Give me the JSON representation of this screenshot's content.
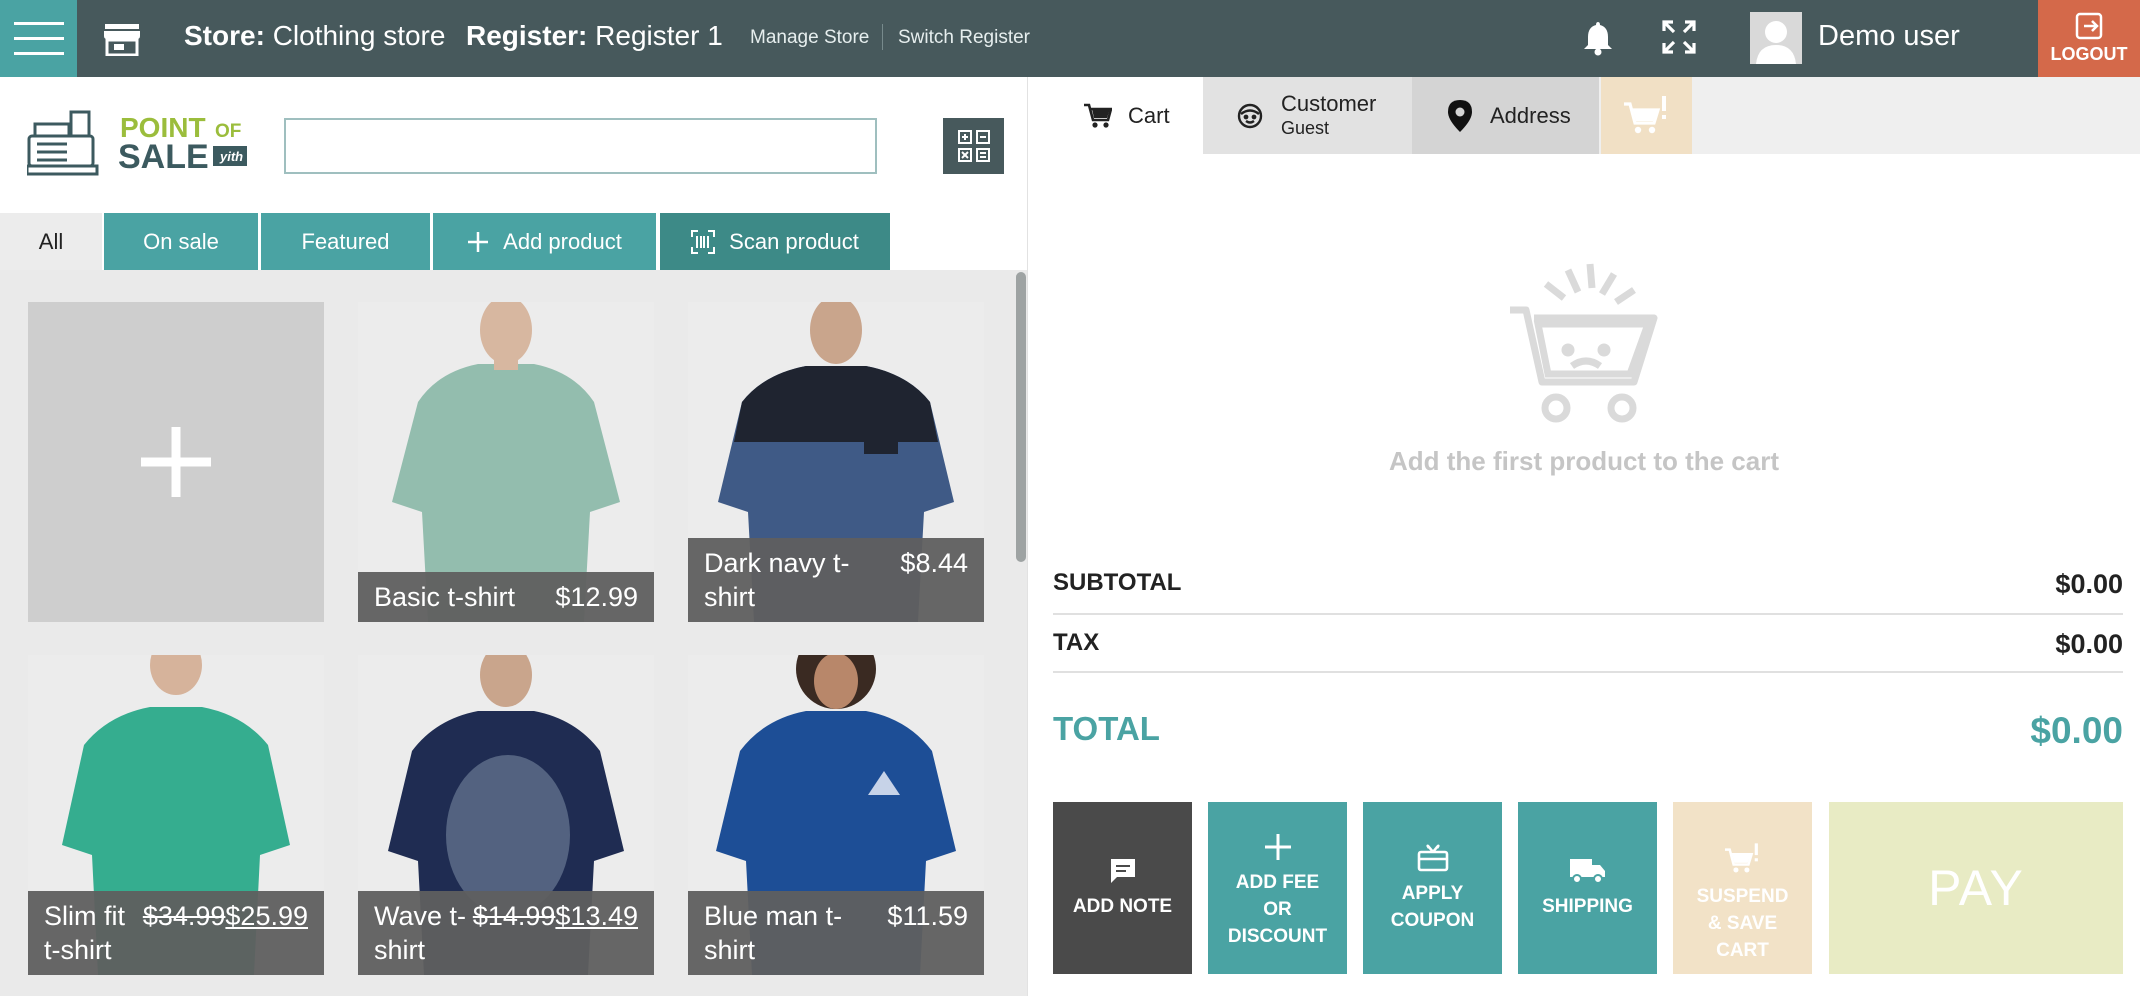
{
  "header": {
    "store_label": "Store:",
    "store_name": "Clothing store",
    "register_label": "Register:",
    "register_name": "Register 1",
    "manage_store": "Manage Store",
    "switch_register": "Switch Register",
    "user_name": "Demo user",
    "logout": "LOGOUT"
  },
  "logo": {
    "line1": "POINT",
    "of": "OF",
    "line2": "SALE",
    "badge": "yith"
  },
  "search": {
    "value": "",
    "placeholder": ""
  },
  "tabs": [
    "All",
    "On sale",
    "Featured",
    "Add product",
    "Scan product"
  ],
  "products": [
    {
      "name": "Basic t-shirt",
      "price": "$12.99",
      "color": "#8fb8a8"
    },
    {
      "name": "Dark navy t-shirt",
      "price": "$8.44",
      "color": "#3f5a86"
    },
    {
      "name": "Slim fit t-shirt",
      "old_price": "$34.99",
      "price": "$25.99",
      "color": "#35ad8f"
    },
    {
      "name": "Wave t-shirt",
      "old_price": "$14.99",
      "price": "$13.49",
      "color": "#1f2c52"
    },
    {
      "name": "Blue man t-shirt",
      "price": "$11.59",
      "color": "#1d4e96"
    }
  ],
  "cart_tabs": {
    "cart": "Cart",
    "customer": "Customer",
    "customer_sub": "Guest",
    "address": "Address"
  },
  "cart": {
    "empty_message": "Add the first product to the cart",
    "subtotal_label": "SUBTOTAL",
    "subtotal": "$0.00",
    "tax_label": "TAX",
    "tax": "$0.00",
    "total_label": "TOTAL",
    "total": "$0.00"
  },
  "actions": {
    "add_note": "ADD NOTE",
    "fee_1": "ADD FEE",
    "fee_2": "OR",
    "fee_3": "DISCOUNT",
    "coupon_1": "APPLY",
    "coupon_2": "COUPON",
    "shipping": "SHIPPING",
    "suspend_1": "SUSPEND",
    "suspend_2": "& SAVE",
    "suspend_3": "CART",
    "pay": "PAY"
  },
  "colors": {
    "teal": "#4aa3a3",
    "dark_header": "#47595c",
    "logout": "#d4694a"
  }
}
